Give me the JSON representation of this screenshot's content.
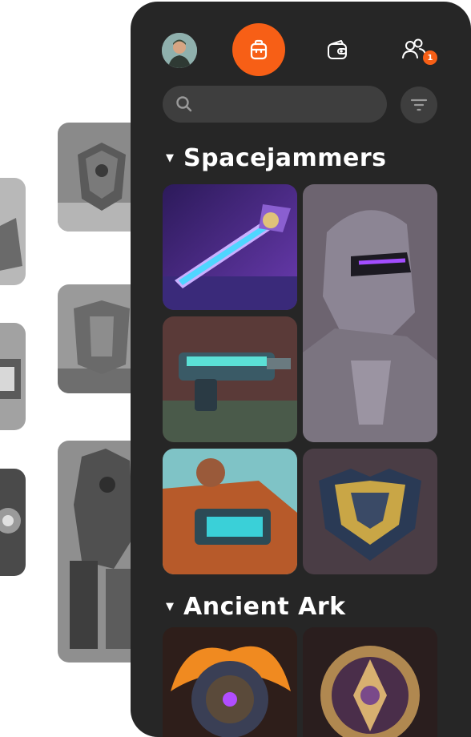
{
  "search": {
    "placeholder": "",
    "icon": "search-icon"
  },
  "nav": {
    "active": "backpack-icon",
    "items": [
      "avatar",
      "backpack-icon",
      "wallet-icon",
      "users-icon"
    ],
    "users_badge": "1",
    "accent": "#f75f16"
  },
  "sections": [
    {
      "title": "Spacejammers",
      "items": [
        "energy-sword",
        "armored-knight",
        "blaster-gun",
        "mech-vehicle",
        "golden-armor"
      ]
    },
    {
      "title": "Ancient Ark",
      "items": [
        "fire-orb",
        "ornate-medallion"
      ]
    }
  ],
  "colors": {
    "panel": "#262626",
    "field": "#3e3e3e",
    "background": "#ffffff"
  }
}
